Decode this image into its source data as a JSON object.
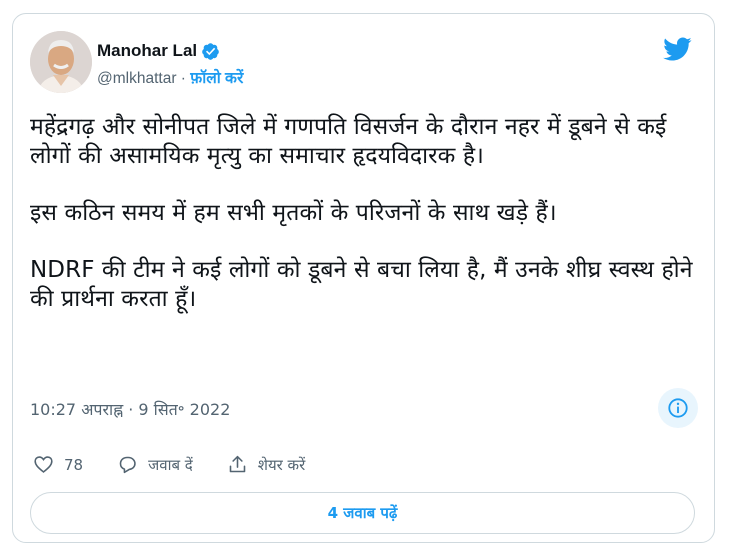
{
  "author": {
    "name": "Manohar Lal",
    "handle": "@mlkhattar",
    "separator": " · ",
    "follow_label": "फ़ॉलो करें"
  },
  "tweet": {
    "paragraphs": [
      "महेंद्रगढ़ और सोनीपत जिले में गणपति विसर्जन के दौरान नहर में डूबने से कई लोगों की असामयिक मृत्यु का समाचार हृदयविदारक है।",
      "इस कठिन समय में हम सभी मृतकों के परिजनों के साथ खड़े हैं।",
      "NDRF की टीम ने कई लोगों को डूबने से बचा लिया है, मैं उनके शीघ्र स्वस्थ होने की प्रार्थना करता हूँ।"
    ],
    "timestamp": "10:27 अपराह्न · 9 सित॰ 2022"
  },
  "actions": {
    "likes": "78",
    "reply_label": "जवाब दें",
    "share_label": "शेयर करें"
  },
  "footer": {
    "read_replies_label": "4 जवाब पढ़ें"
  },
  "colors": {
    "accent": "#1d9bf0",
    "muted": "#536471",
    "border": "#cfd9de"
  },
  "icons": {
    "logo": "twitter-bird-icon",
    "verified": "verified-badge-icon",
    "info": "info-icon",
    "like": "heart-icon",
    "reply": "comment-icon",
    "share": "share-icon"
  }
}
